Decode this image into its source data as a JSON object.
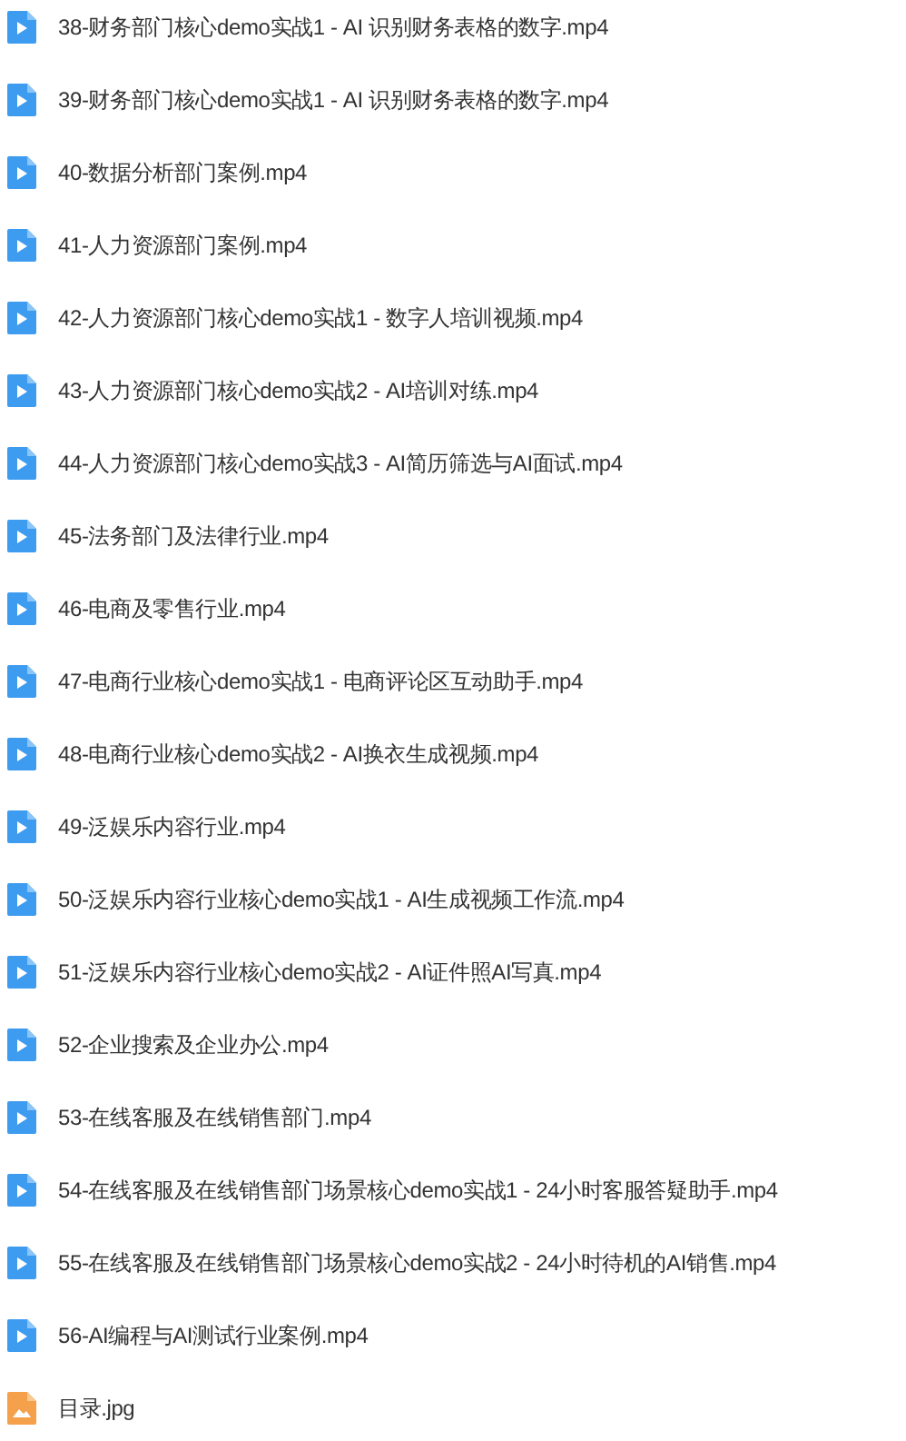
{
  "files": [
    {
      "kind": "video",
      "name": "38-财务部门核心demo实战1 - AI 识别财务表格的数字.mp4"
    },
    {
      "kind": "video",
      "name": "39-财务部门核心demo实战1 - AI 识别财务表格的数字.mp4"
    },
    {
      "kind": "video",
      "name": "40-数据分析部门案例.mp4"
    },
    {
      "kind": "video",
      "name": "41-人力资源部门案例.mp4"
    },
    {
      "kind": "video",
      "name": "42-人力资源部门核心demo实战1 - 数字人培训视频.mp4"
    },
    {
      "kind": "video",
      "name": "43-人力资源部门核心demo实战2 - AI培训对练.mp4"
    },
    {
      "kind": "video",
      "name": "44-人力资源部门核心demo实战3 - AI简历筛选与AI面试.mp4"
    },
    {
      "kind": "video",
      "name": "45-法务部门及法律行业.mp4"
    },
    {
      "kind": "video",
      "name": "46-电商及零售行业.mp4"
    },
    {
      "kind": "video",
      "name": "47-电商行业核心demo实战1 - 电商评论区互动助手.mp4"
    },
    {
      "kind": "video",
      "name": "48-电商行业核心demo实战2 - AI换衣生成视频.mp4"
    },
    {
      "kind": "video",
      "name": "49-泛娱乐内容行业.mp4"
    },
    {
      "kind": "video",
      "name": "50-泛娱乐内容行业核心demo实战1 - AI生成视频工作流.mp4"
    },
    {
      "kind": "video",
      "name": "51-泛娱乐内容行业核心demo实战2 - AI证件照AI写真.mp4"
    },
    {
      "kind": "video",
      "name": "52-企业搜索及企业办公.mp4"
    },
    {
      "kind": "video",
      "name": "53-在线客服及在线销售部门.mp4"
    },
    {
      "kind": "video",
      "name": "54-在线客服及在线销售部门场景核心demo实战1 - 24小时客服答疑助手.mp4"
    },
    {
      "kind": "video",
      "name": "55-在线客服及在线销售部门场景核心demo实战2 - 24小时待机的AI销售.mp4"
    },
    {
      "kind": "video",
      "name": "56-AI编程与AI测试行业案例.mp4"
    },
    {
      "kind": "image",
      "name": "目录.jpg"
    }
  ]
}
